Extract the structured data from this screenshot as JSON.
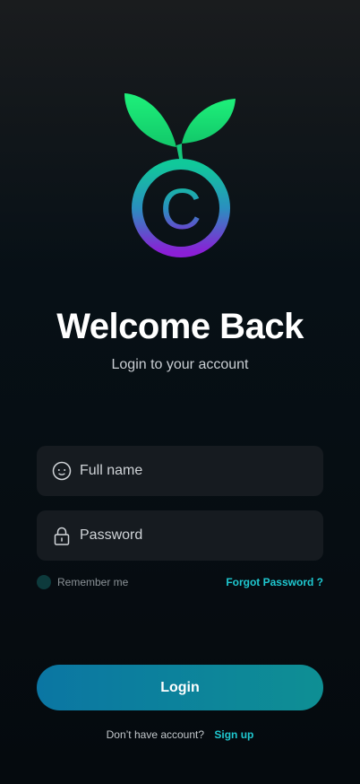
{
  "logo": {
    "name": "sprout-copyright-logo"
  },
  "header": {
    "title": "Welcome Back",
    "subtitle": "Login to your account"
  },
  "form": {
    "fullname": {
      "placeholder": "Full name",
      "value": "",
      "icon": "face-icon"
    },
    "password": {
      "placeholder": "Password",
      "value": "",
      "icon": "lock-icon"
    },
    "remember_label": "Remember me",
    "forgot_label": "Forgot Password ?",
    "login_label": "Login"
  },
  "footer": {
    "prompt": "Don’t have account?",
    "signup_label": "Sign up"
  },
  "colors": {
    "accent": "#1fc8d0",
    "button_gradient_start": "#0b76a3",
    "button_gradient_end": "#0e8f94",
    "field_bg": "#161b20"
  }
}
